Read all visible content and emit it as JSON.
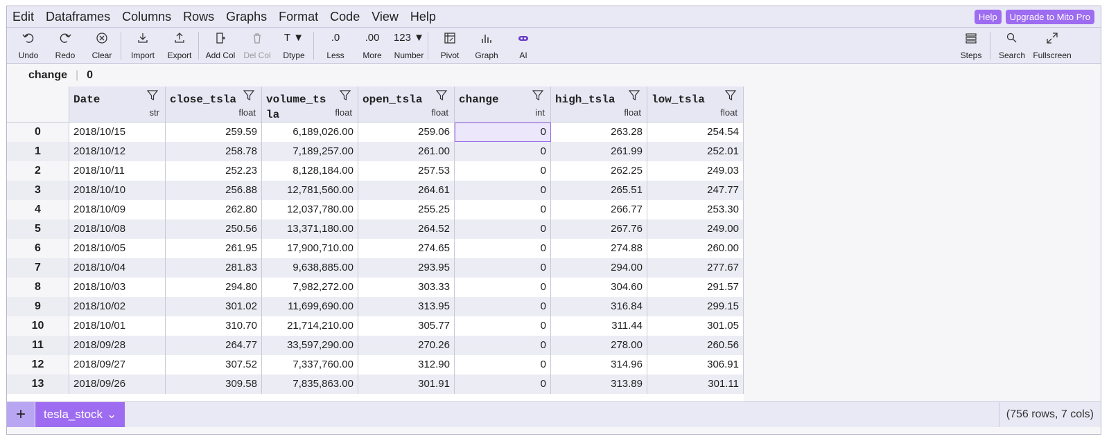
{
  "menubar": {
    "items": [
      "Edit",
      "Dataframes",
      "Columns",
      "Rows",
      "Graphs",
      "Format",
      "Code",
      "View",
      "Help"
    ],
    "help_button": "Help",
    "upgrade_button": "Upgrade to Mito Pro"
  },
  "toolbar": {
    "undo": "Undo",
    "redo": "Redo",
    "clear": "Clear",
    "import": "Import",
    "export": "Export",
    "add_col": "Add Col",
    "del_col": "Del Col",
    "dtype": "Dtype",
    "less": "Less",
    "less_icon": ".0",
    "more": "More",
    "more_icon": ".00",
    "number": "Number",
    "number_icon": "123",
    "pivot": "Pivot",
    "graph": "Graph",
    "ai": "AI",
    "steps": "Steps",
    "search": "Search",
    "fullscreen": "Fullscreen",
    "dtype_icon": "T"
  },
  "formula_bar": {
    "column": "change",
    "value": "0"
  },
  "grid": {
    "columns": [
      {
        "name": "Date",
        "dtype": "str"
      },
      {
        "name": "close_tsla",
        "dtype": "float"
      },
      {
        "name": "volume_tsla",
        "dtype": "float"
      },
      {
        "name": "open_tsla",
        "dtype": "float"
      },
      {
        "name": "change",
        "dtype": "int"
      },
      {
        "name": "high_tsla",
        "dtype": "float"
      },
      {
        "name": "low_tsla",
        "dtype": "float"
      }
    ],
    "rows": [
      {
        "index": "0",
        "cells": [
          "2018/10/15",
          "259.59",
          "6,189,026.00",
          "259.06",
          "0",
          "263.28",
          "254.54"
        ]
      },
      {
        "index": "1",
        "cells": [
          "2018/10/12",
          "258.78",
          "7,189,257.00",
          "261.00",
          "0",
          "261.99",
          "252.01"
        ]
      },
      {
        "index": "2",
        "cells": [
          "2018/10/11",
          "252.23",
          "8,128,184.00",
          "257.53",
          "0",
          "262.25",
          "249.03"
        ]
      },
      {
        "index": "3",
        "cells": [
          "2018/10/10",
          "256.88",
          "12,781,560.00",
          "264.61",
          "0",
          "265.51",
          "247.77"
        ]
      },
      {
        "index": "4",
        "cells": [
          "2018/10/09",
          "262.80",
          "12,037,780.00",
          "255.25",
          "0",
          "266.77",
          "253.30"
        ]
      },
      {
        "index": "5",
        "cells": [
          "2018/10/08",
          "250.56",
          "13,371,180.00",
          "264.52",
          "0",
          "267.76",
          "249.00"
        ]
      },
      {
        "index": "6",
        "cells": [
          "2018/10/05",
          "261.95",
          "17,900,710.00",
          "274.65",
          "0",
          "274.88",
          "260.00"
        ]
      },
      {
        "index": "7",
        "cells": [
          "2018/10/04",
          "281.83",
          "9,638,885.00",
          "293.95",
          "0",
          "294.00",
          "277.67"
        ]
      },
      {
        "index": "8",
        "cells": [
          "2018/10/03",
          "294.80",
          "7,982,272.00",
          "303.33",
          "0",
          "304.60",
          "291.57"
        ]
      },
      {
        "index": "9",
        "cells": [
          "2018/10/02",
          "301.02",
          "11,699,690.00",
          "313.95",
          "0",
          "316.84",
          "299.15"
        ]
      },
      {
        "index": "10",
        "cells": [
          "2018/10/01",
          "310.70",
          "21,714,210.00",
          "305.77",
          "0",
          "311.44",
          "301.05"
        ]
      },
      {
        "index": "11",
        "cells": [
          "2018/09/28",
          "264.77",
          "33,597,290.00",
          "270.26",
          "0",
          "278.00",
          "260.56"
        ]
      },
      {
        "index": "12",
        "cells": [
          "2018/09/27",
          "307.52",
          "7,337,760.00",
          "312.90",
          "0",
          "314.96",
          "306.91"
        ]
      },
      {
        "index": "13",
        "cells": [
          "2018/09/26",
          "309.58",
          "7,835,863.00",
          "301.91",
          "0",
          "313.89",
          "301.11"
        ]
      }
    ],
    "selected_cell": {
      "row": 0,
      "col": 4
    }
  },
  "footer": {
    "add_sheet": "+",
    "sheet_name": "tesla_stock",
    "sheet_dropdown": "⌄",
    "row_count": "(756 rows, 7 cols)"
  },
  "colors": {
    "accent": "#9d6cf0",
    "header_bg": "#e6e7f3",
    "toolbar_bg": "#e9e9f5"
  }
}
